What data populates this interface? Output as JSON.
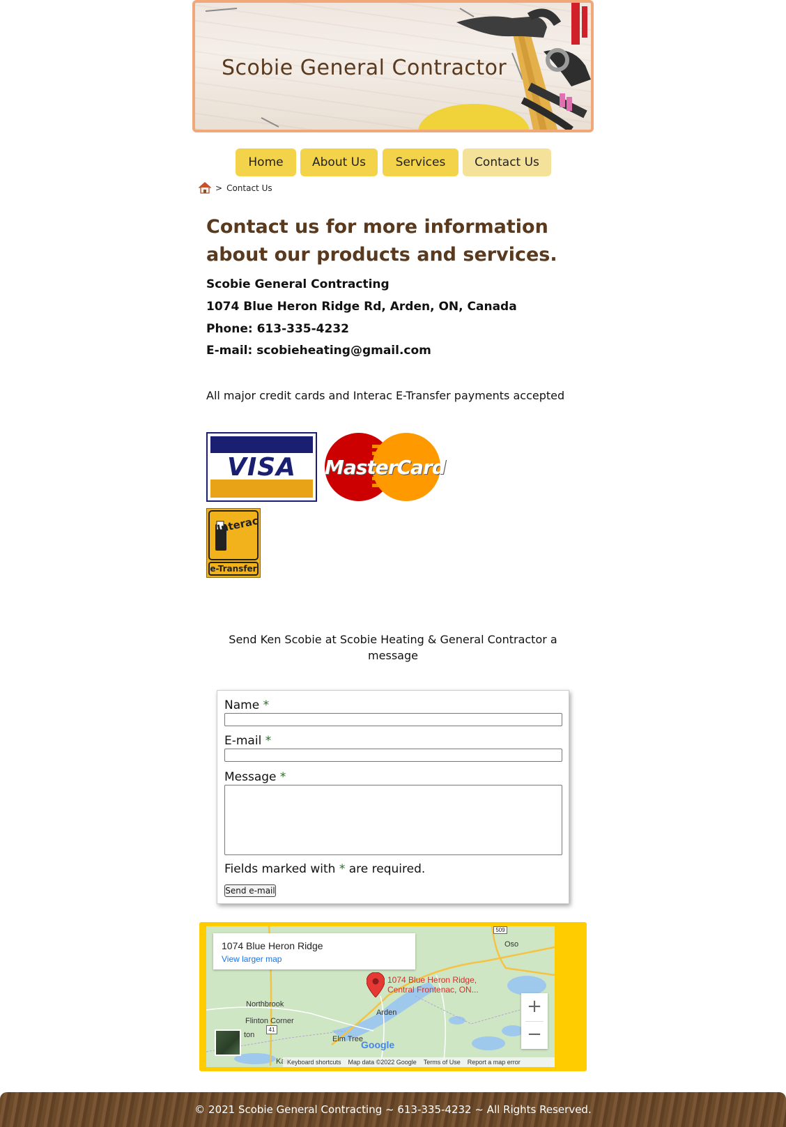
{
  "banner": {
    "title": "Scobie General Contractor"
  },
  "nav": [
    {
      "label": "Home"
    },
    {
      "label": "About Us"
    },
    {
      "label": "Services"
    },
    {
      "label": "Contact Us"
    }
  ],
  "breadcrumb": {
    "separator": ">",
    "current": "Contact Us"
  },
  "heading": "Contact us for more information about our products and services.",
  "business": {
    "name": "Scobie General Contracting",
    "address": "1074 Blue Heron Ridge Rd, Arden, ON, Canada",
    "phone": "Phone: 613-335-4232",
    "email": "E-mail: scobieheating@gmail.com"
  },
  "payments_note": "All major credit cards and Interac E-Transfer payments accepted",
  "logos": {
    "visa": "VISA",
    "mastercard": "MasterCard",
    "interac": "Interac",
    "interac_sub": "e-Transfer"
  },
  "form": {
    "intro": "Send Ken Scobie at Scobie Heating & General Contractor a message",
    "name_label": "Name",
    "email_label": "E-mail",
    "message_label": "Message",
    "required_mark": "*",
    "required_note_pre": "Fields marked with",
    "required_note_post": "are required.",
    "submit": "Send e-mail",
    "name_value": "",
    "email_value": "",
    "message_value": ""
  },
  "map": {
    "card_title": "1074 Blue Heron Ridge",
    "card_link": "View larger map",
    "pin_label_1": "1074 Blue Heron Ridge,",
    "pin_label_2": "Central Frontenac, ON...",
    "places": [
      "Oso",
      "Northbrook",
      "Flinton Corner",
      "Arden",
      "Elm Tree",
      "ton",
      "Kal"
    ],
    "road_numbers": [
      "509",
      "41"
    ],
    "zoom_in": "+",
    "zoom_out": "−",
    "footer_items": [
      "Keyboard shortcuts",
      "Map data ©2022 Google",
      "Terms of Use",
      "Report a map error"
    ],
    "google": "Google"
  },
  "footer": {
    "text": "© 2021 Scobie General Contracting ~ 613-335-4232  ~  All Rights Reserved."
  },
  "colors": {
    "nav": "#f3d34a",
    "nav_active": "#f4e29a",
    "heading": "#5a3a1e",
    "map_frame": "#ffcc00",
    "footer": "#6b4a2a"
  }
}
